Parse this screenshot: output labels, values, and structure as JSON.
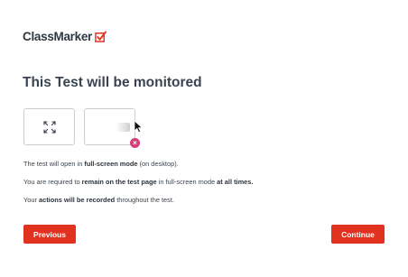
{
  "header": {
    "logo_text": "ClassMarker",
    "logo_icon": "checkbox-check-icon",
    "accent_color": "#e0321f"
  },
  "main": {
    "title": "This Test will be monitored",
    "tiles": [
      {
        "icon": "fullscreen-icon"
      },
      {
        "icon": "mouse-pointer-icon",
        "badge_icon": "close-icon"
      }
    ],
    "info_lines": [
      {
        "before": "The test will open in ",
        "bold": "full-screen mode",
        "after": " (on desktop)."
      },
      {
        "before": "You are required to ",
        "bold": "remain on the test page",
        "middle": " in full-screen mode ",
        "bold2": "at all times.",
        "after": ""
      },
      {
        "before": "Your ",
        "bold": "actions will be recorded",
        "after": " throughout the test."
      }
    ]
  },
  "footer": {
    "previous_label": "Previous",
    "continue_label": "Continue"
  }
}
